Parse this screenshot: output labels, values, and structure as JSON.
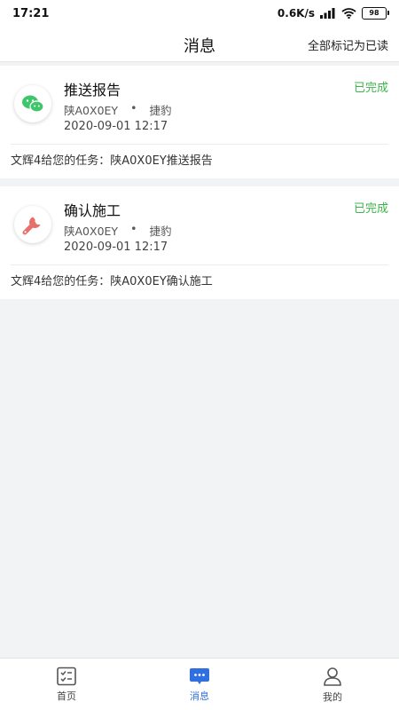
{
  "status_bar": {
    "time": "17:21",
    "net_speed": "0.6K/s",
    "battery": "98"
  },
  "header": {
    "title": "消息",
    "mark_all_label": "全部标记为已读"
  },
  "messages": [
    {
      "icon": "wechat-icon",
      "title": "推送报告",
      "status": "已完成",
      "plate": "陕A0X0EY",
      "separator": "•",
      "vehicle": "捷豹",
      "time": "2020-09-01 12:17",
      "description": "文辉4给您的任务：陕A0X0EY推送报告"
    },
    {
      "icon": "wrench-icon",
      "title": "确认施工",
      "status": "已完成",
      "plate": "陕A0X0EY",
      "separator": "•",
      "vehicle": "捷豹",
      "time": "2020-09-01 12:17",
      "description": "文辉4给您的任务：陕A0X0EY确认施工"
    }
  ],
  "tabbar": {
    "tabs": [
      {
        "label": "首页",
        "icon": "home-icon"
      },
      {
        "label": "消息",
        "icon": "message-icon"
      },
      {
        "label": "我的",
        "icon": "profile-icon"
      }
    ],
    "active_index": 1
  },
  "colors": {
    "status_done": "#3bb54a",
    "accent": "#2f6fe0",
    "wechat_green": "#3fc56b",
    "wrench_red": "#e8706a"
  }
}
